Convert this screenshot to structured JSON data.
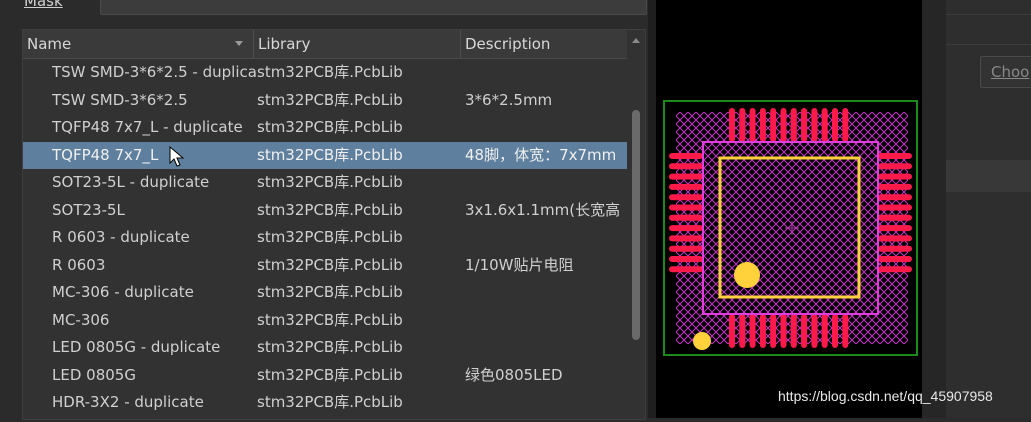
{
  "filter": {
    "mask_label": "Mask",
    "mask_value": ""
  },
  "table": {
    "columns": {
      "name": "Name",
      "library": "Library",
      "description": "Description"
    },
    "rows": [
      {
        "name": "TSW SMD-3*6*2.5 - duplicate",
        "library": "stm32PCB库.PcbLib",
        "description": ""
      },
      {
        "name": "TSW SMD-3*6*2.5",
        "library": "stm32PCB库.PcbLib",
        "description": "3*6*2.5mm"
      },
      {
        "name": "TQFP48 7x7_L - duplicate",
        "library": "stm32PCB库.PcbLib",
        "description": ""
      },
      {
        "name": "TQFP48 7x7_L",
        "library": "stm32PCB库.PcbLib",
        "description": "48脚，体宽：7x7mm"
      },
      {
        "name": "SOT23-5L - duplicate",
        "library": "stm32PCB库.PcbLib",
        "description": ""
      },
      {
        "name": "SOT23-5L",
        "library": "stm32PCB库.PcbLib",
        "description": "3x1.6x1.1mm(长宽高"
      },
      {
        "name": "R 0603 - duplicate",
        "library": "stm32PCB库.PcbLib",
        "description": ""
      },
      {
        "name": "R 0603",
        "library": "stm32PCB库.PcbLib",
        "description": "1/10W贴片电阻"
      },
      {
        "name": "MC-306 - duplicate",
        "library": "stm32PCB库.PcbLib",
        "description": ""
      },
      {
        "name": "MC-306",
        "library": "stm32PCB库.PcbLib",
        "description": ""
      },
      {
        "name": "LED 0805G - duplicate",
        "library": "stm32PCB库.PcbLib",
        "description": ""
      },
      {
        "name": "LED 0805G",
        "library": "stm32PCB库.PcbLib",
        "description": "绿色0805LED"
      },
      {
        "name": "HDR-3X2 - duplicate",
        "library": "stm32PCB库.PcbLib",
        "description": ""
      }
    ],
    "selected_index": 3
  },
  "right_panel": {
    "choose_label": "Choo"
  },
  "watermark": "https://blog.csdn.net/qq_45907958",
  "colors": {
    "selection": "#5e7f9e",
    "pad": "#ff1a4a",
    "silkscreen": "#ffd23c",
    "courtyard": "#e03ce0",
    "board_outline": "#1a8a1a"
  },
  "icons": [
    "sort-down-icon",
    "scroll-up-icon",
    "mouse-cursor-icon"
  ]
}
